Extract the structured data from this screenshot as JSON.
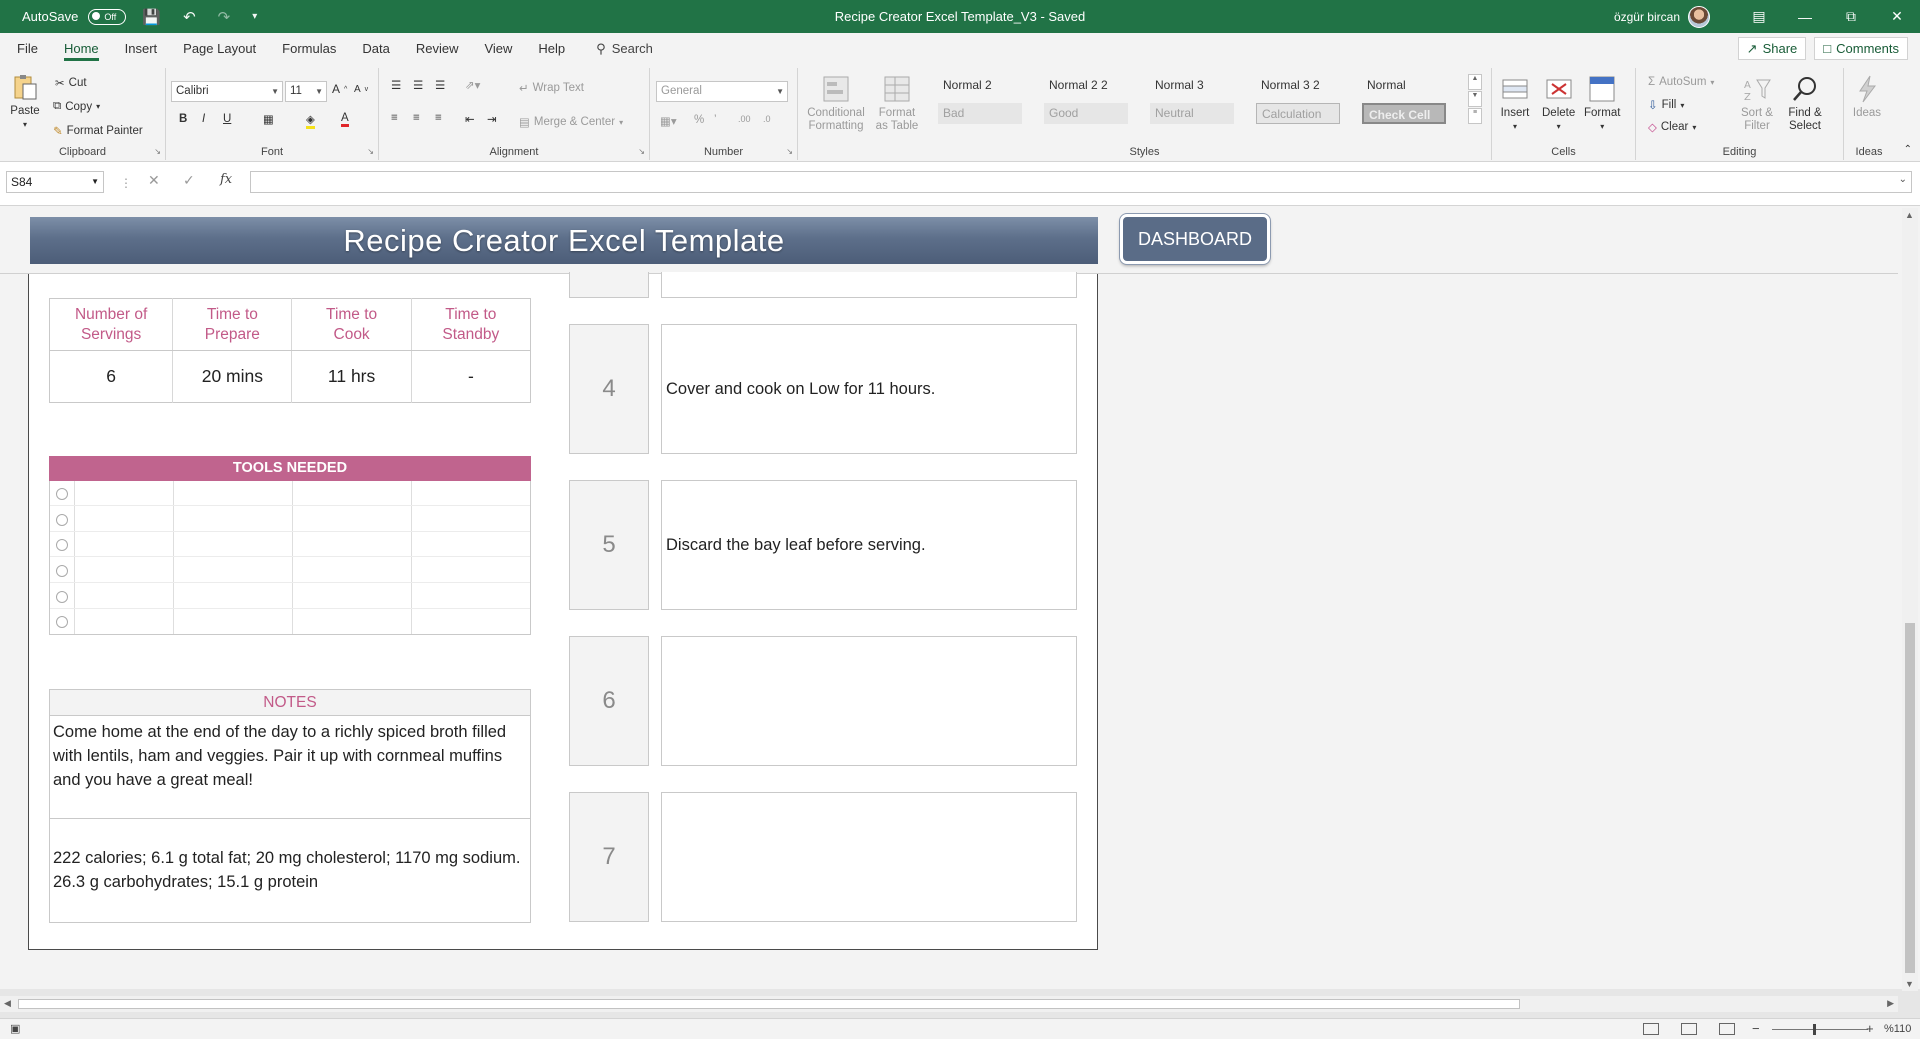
{
  "titlebar": {
    "autosave_label": "AutoSave",
    "autosave_state": "Off",
    "document_title": "Recipe Creator Excel Template_V3  -  Saved",
    "user_name": "özgür bircan"
  },
  "tabs": [
    "File",
    "Home",
    "Insert",
    "Page Layout",
    "Formulas",
    "Data",
    "Review",
    "View",
    "Help"
  ],
  "search_label": "Search",
  "share_label": "Share",
  "comments_label": "Comments",
  "ribbon": {
    "clipboard": {
      "paste": "Paste",
      "cut": "Cut",
      "copy": "Copy",
      "format_painter": "Format Painter",
      "label": "Clipboard"
    },
    "font": {
      "name": "Calibri",
      "size": "11",
      "label": "Font"
    },
    "alignment": {
      "wrap_text": "Wrap Text",
      "merge_center": "Merge & Center",
      "label": "Alignment"
    },
    "number": {
      "format": "General",
      "label": "Number"
    },
    "styles": {
      "conditional_formatting": "Conditional Formatting",
      "format_as_table": "Format as Table",
      "cells": [
        "Normal 2",
        "Normal 2 2",
        "Normal 3",
        "Normal 3 2",
        "Normal",
        "Bad",
        "Good",
        "Neutral",
        "Calculation",
        "Check Cell"
      ],
      "label": "Styles"
    },
    "cells": {
      "insert": "Insert",
      "delete": "Delete",
      "format": "Format",
      "label": "Cells"
    },
    "editing": {
      "autosum": "AutoSum",
      "fill": "Fill",
      "clear": "Clear",
      "sort_filter": "Sort & Filter",
      "find_select": "Find & Select",
      "label": "Editing"
    },
    "ideas": {
      "ideas": "Ideas",
      "label": "Ideas"
    }
  },
  "formula_bar": {
    "name_box": "S84",
    "fx": "fx",
    "value": ""
  },
  "sheet": {
    "banner_title": "Recipe Creator Excel Template",
    "dashboard_button": "DASHBOARD",
    "info_headers": [
      "Number of Servings",
      "Time to Prepare",
      "Time to Cook",
      "Time to Standby"
    ],
    "info_values": [
      "6",
      "20 mins",
      "11 hrs",
      "-"
    ],
    "tools_header": "TOOLS NEEDED",
    "notes_header": "NOTES",
    "notes_text": "Come home at the end of the day to a richly spiced broth filled with lentils, ham and veggies. Pair it up with cornmeal muffins and you have a great meal!",
    "nutrition_text": "222 calories; 6.1 g total fat; 20 mg cholesterol; 1170 mg sodium. 26.3 g carbohydrates; 15.1 g protein",
    "steps": [
      {
        "num": "4",
        "text": "Cover and cook on Low for 11 hours."
      },
      {
        "num": "5",
        "text": "Discard the bay leaf before serving."
      },
      {
        "num": "6",
        "text": ""
      },
      {
        "num": "7",
        "text": ""
      }
    ]
  },
  "status": {
    "zoom": "%110"
  }
}
